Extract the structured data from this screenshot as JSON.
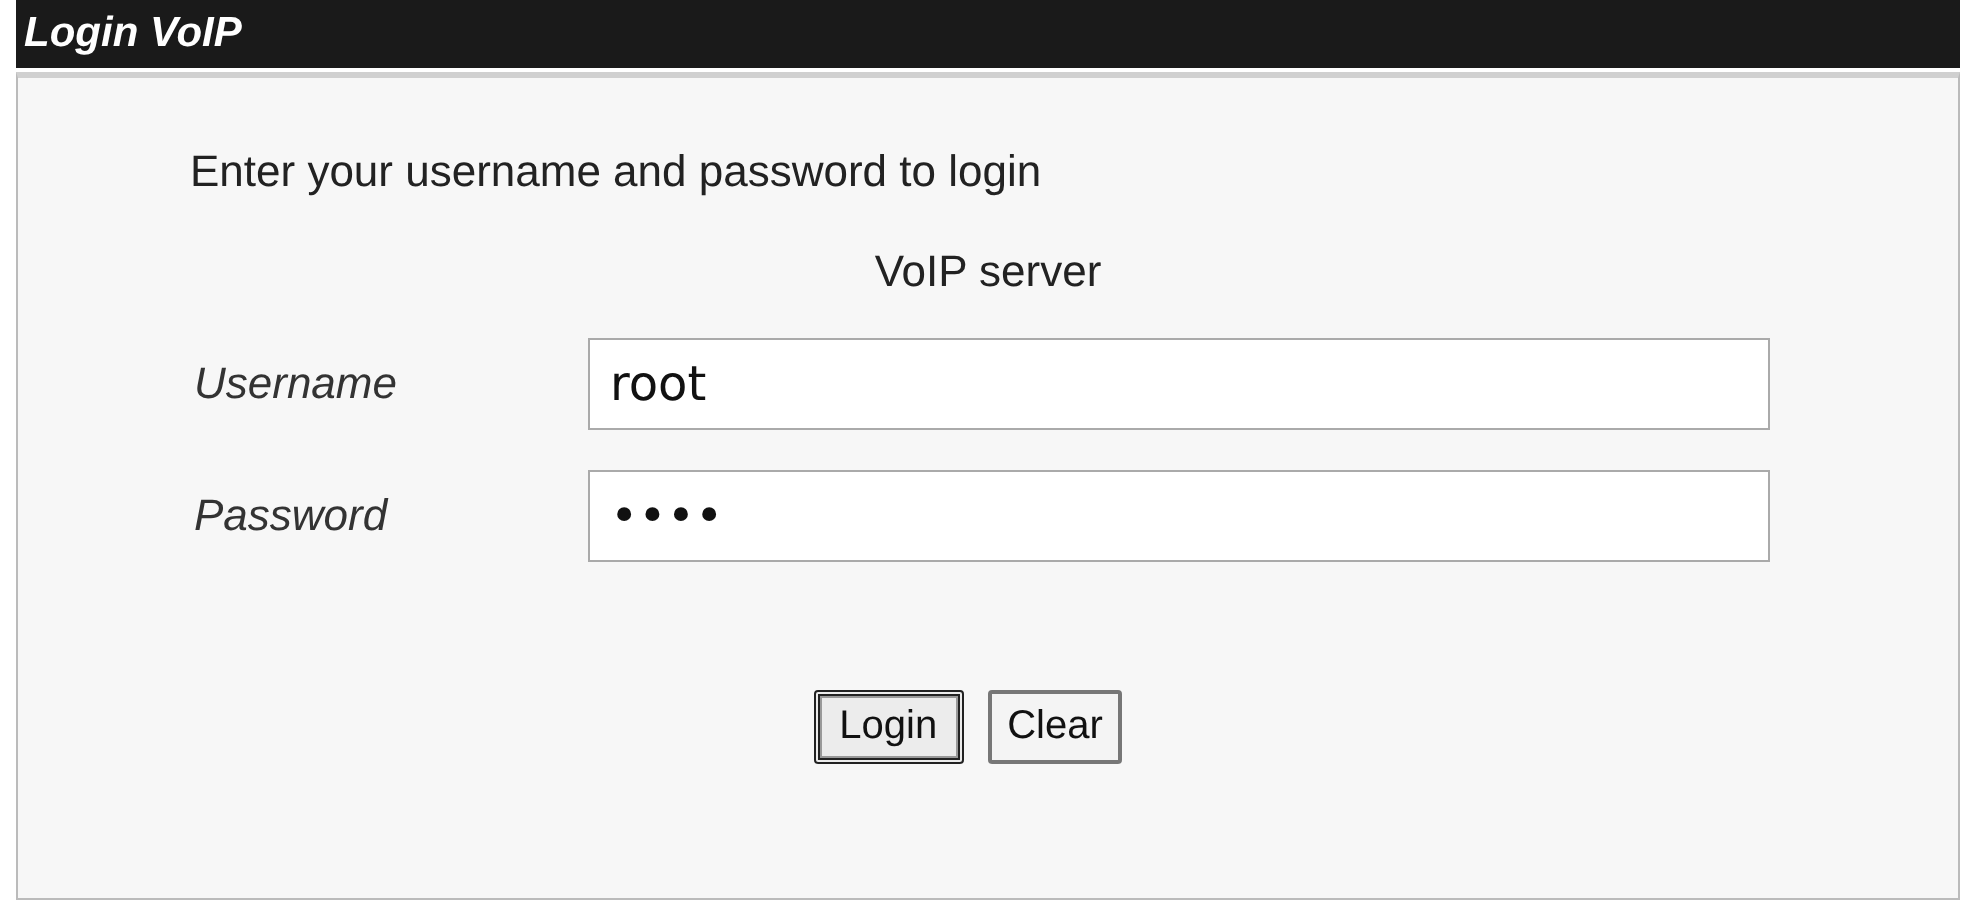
{
  "window": {
    "title": "Login VoIP"
  },
  "intro": [
    "Enter your username and password to login",
    "VoIP server"
  ],
  "fields": [
    {
      "label": "Username",
      "value": "root"
    },
    {
      "label": "Password",
      "value": "••••"
    }
  ],
  "buttons": [
    {
      "label": "Login",
      "focused": true
    },
    {
      "label": "Clear",
      "focused": false
    }
  ]
}
